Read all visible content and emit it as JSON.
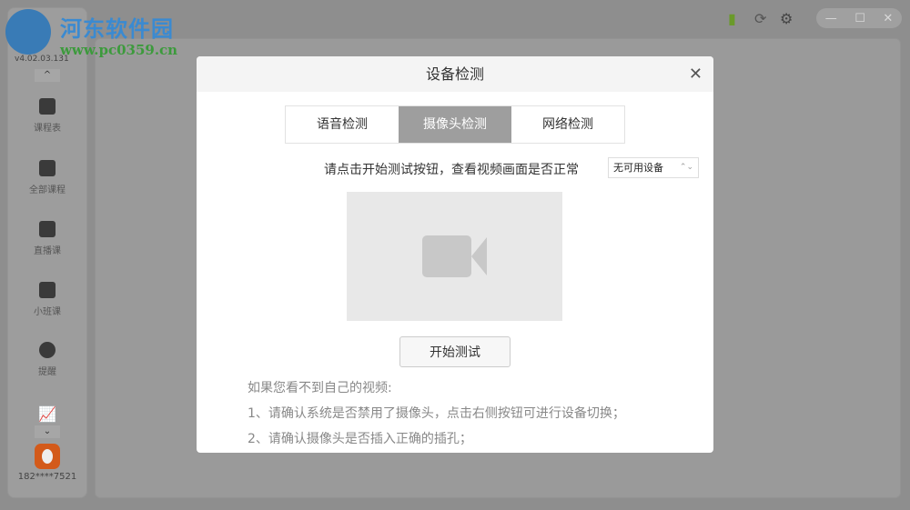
{
  "watermark": {
    "title": "河东软件园",
    "url": "www.pc0359.cn"
  },
  "app": {
    "version": "v4.02.03.131"
  },
  "sidebar": {
    "items": [
      {
        "label": "课程表",
        "icon": "calendar-check-icon"
      },
      {
        "label": "全部课程",
        "icon": "books-icon"
      },
      {
        "label": "直播课",
        "icon": "tv-play-icon"
      },
      {
        "label": "小班课",
        "icon": "class-icon"
      },
      {
        "label": "提醒",
        "icon": "chat-bubble-icon"
      }
    ],
    "user": "182****7521",
    "up": "^",
    "down": "⌄"
  },
  "topbar": {
    "signal_color": "#6a9a2a",
    "minimize": "—",
    "maximize": "☐",
    "close": "✕"
  },
  "modal": {
    "title": "设备检测",
    "close": "✕",
    "tabs": [
      {
        "label": "语音检测"
      },
      {
        "label": "摄像头检测",
        "active": true
      },
      {
        "label": "网络检测"
      }
    ],
    "hint": "请点击开始测试按钮，查看视频画面是否正常",
    "device_select": "无可用设备",
    "start_button": "开始测试",
    "tips": [
      "如果您看不到自己的视频:",
      "1、请确认系统是否禁用了摄像头，点击右侧按钮可进行设备切换；",
      "2、请确认摄像头是否插入正确的插孔；"
    ]
  }
}
